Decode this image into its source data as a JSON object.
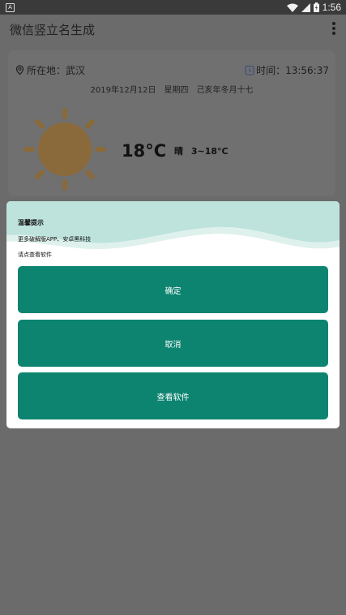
{
  "status_bar": {
    "time": "1:56",
    "notif_icon": "A"
  },
  "app_bar": {
    "title": "微信竖立名生成",
    "menu_icon": "more-vert-icon"
  },
  "weather_card": {
    "location_label": "所在地：武汉",
    "time_label": "时间：13:56:37",
    "date_line": "2019年12月12日　星期四　己亥年冬月十七",
    "temperature": "18°C",
    "condition": "晴",
    "range": "3~18°C",
    "icons": [
      "location-icon",
      "clock-icon",
      "sun-icon"
    ]
  },
  "dialog": {
    "title": "温馨提示",
    "line1": "更多破解版APP、安卓黑科技",
    "line2": "请点查看软件",
    "buttons": [
      "确定",
      "取消",
      "查看软件"
    ],
    "button_color": "#0d8470",
    "wave_color": "#bde3dc"
  }
}
